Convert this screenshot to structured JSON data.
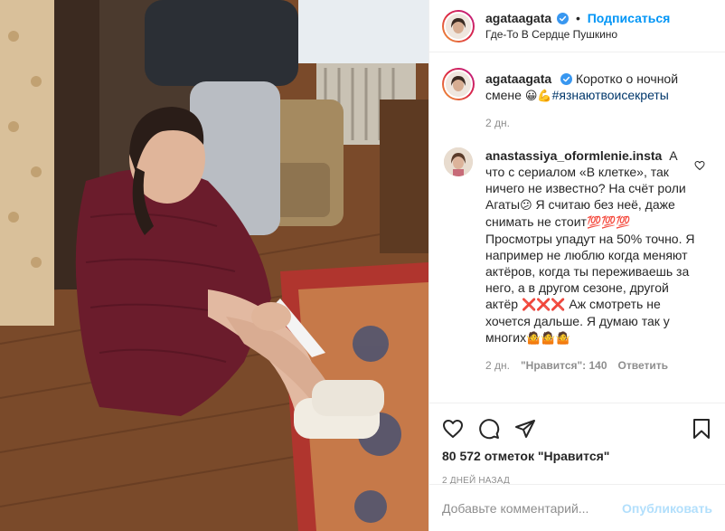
{
  "post": {
    "author": "agataagata",
    "follow_label": "Подписаться",
    "location": "Где-То В Сердце Пушкино",
    "caption_text": "Коротко о ночной смене",
    "caption_emoji": "😀💪",
    "caption_hashtag": "#язнаютвоисекреты",
    "caption_time": "2 дн."
  },
  "comments": [
    {
      "author": "anastassiya_oformlenie.insta",
      "text_1": "А что с сериалом «В клетке», так ничего не известно? На счёт роли Агаты",
      "emoji_1": "😕",
      "text_2": " Я считаю без неё, даже снимать не стоит",
      "emoji_2": "💯💯💯",
      "text_3": " Просмотры упадут на 50% точно. Я например не люблю когда меняют актёров, когда ты переживаешь за него, а в другом сезоне, другой актёр ",
      "emoji_3": "❌❌❌",
      "text_4": " Аж смотреть не хочется дальше. Я думаю так у многих",
      "emoji_4": "🤷🤷🤷",
      "time": "2 дн.",
      "likes": "\"Нравится\": 140",
      "reply_label": "Ответить"
    }
  ],
  "actions": {
    "likes_text": "80 572 отметок \"Нравится\"",
    "date": "2 дней назад"
  },
  "add_comment": {
    "placeholder": "Добавьте комментарий...",
    "publish_label": "Опубликовать"
  },
  "icons": {
    "like": "heart-icon",
    "comment": "comment-icon",
    "share": "paper-plane-icon",
    "save": "bookmark-icon",
    "verified": "verified-badge-icon"
  },
  "colors": {
    "accent": "#0095f6",
    "hashtag": "#00376b",
    "muted": "#8e8e8e",
    "publish_disabled": "#b2dffc"
  }
}
